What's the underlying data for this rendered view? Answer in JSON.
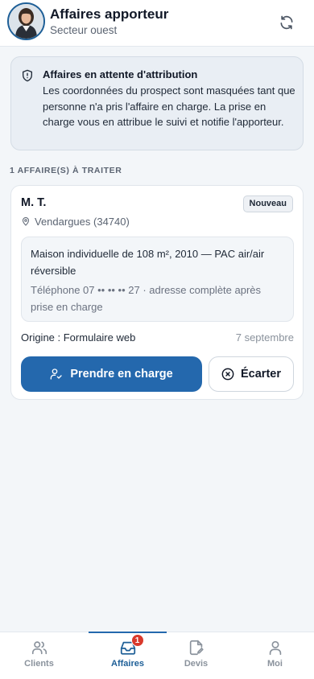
{
  "header": {
    "title": "Affaires apporteur",
    "subtitle": "Secteur ouest",
    "refresh_icon": "refresh-icon"
  },
  "info_banner": {
    "icon": "shield-alert-icon",
    "title": "Affaires en attente d'attribution",
    "text": "Les coordonnées du prospect sont masquées tant que personne n'a pris l'affaire en charge. La prise en charge vous en attribue le suivi et notifie l'apporteur."
  },
  "section_label": "1 AFFAIRE(S) À TRAITER",
  "card": {
    "name": "M. T.",
    "badge": "Nouveau",
    "location": "Vendargues (34740)",
    "description": "Maison individuelle de 108 m², 2010 — PAC air/air réversible",
    "hint": "Téléphone 07 •• •• •• 27 · adresse complète après prise en charge",
    "origin": "Origine : Formulaire web",
    "date": "7 septembre",
    "primary_button": "Prendre en charge",
    "secondary_button": "Écarter"
  },
  "nav": {
    "items": [
      {
        "label": "Clients",
        "icon": "users-icon",
        "active": false
      },
      {
        "label": "Affaires",
        "icon": "inbox-icon",
        "active": true,
        "badge": "1"
      },
      {
        "label": "Devis",
        "icon": "edit-document-icon",
        "active": false
      },
      {
        "label": "Moi",
        "icon": "user-icon",
        "active": false
      }
    ]
  },
  "colors": {
    "accent": "#2468ad",
    "badge_red": "#d9392c",
    "background": "#f3f6f9"
  }
}
